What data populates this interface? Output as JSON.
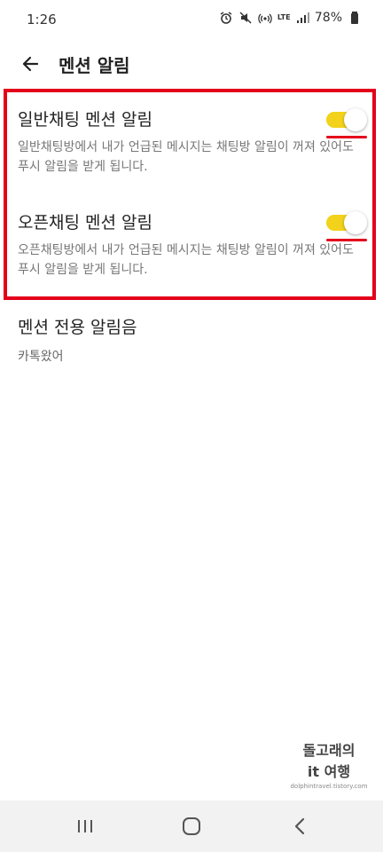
{
  "status": {
    "time": "1:26",
    "battery_percent": "78%",
    "icons": [
      "alarm-icon",
      "mute-icon",
      "hotspot-icon",
      "lte-icon",
      "signal-icon",
      "battery-icon"
    ],
    "lte_label": "LTE"
  },
  "header": {
    "title": "멘션 알림",
    "back_icon": "back-arrow-icon"
  },
  "settings": [
    {
      "title": "일반채팅 멘션 알림",
      "description": "일반채팅방에서 내가 언급된 메시지는 채팅방 알림이 꺼져 있어도 푸시 알림을 받게 됩니다.",
      "enabled": true
    },
    {
      "title": "오픈채팅 멘션 알림",
      "description": "오픈채팅방에서 내가 언급된 메시지는 채팅방 알림이 꺼져 있어도 푸시 알림을 받게 됩니다.",
      "enabled": true
    }
  ],
  "sound_setting": {
    "title": "멘션 전용 알림음",
    "value": "카톡왔어"
  },
  "watermark": {
    "line1": "돌고래의",
    "line2": "it 여행",
    "site": "dolphintravel.tistory.com"
  },
  "colors": {
    "toggle_on": "#f2d21a",
    "highlight": "#e3001b",
    "nav_bg": "#f2f2f2"
  },
  "nav": [
    "recent-apps-icon",
    "home-icon",
    "back-icon"
  ]
}
